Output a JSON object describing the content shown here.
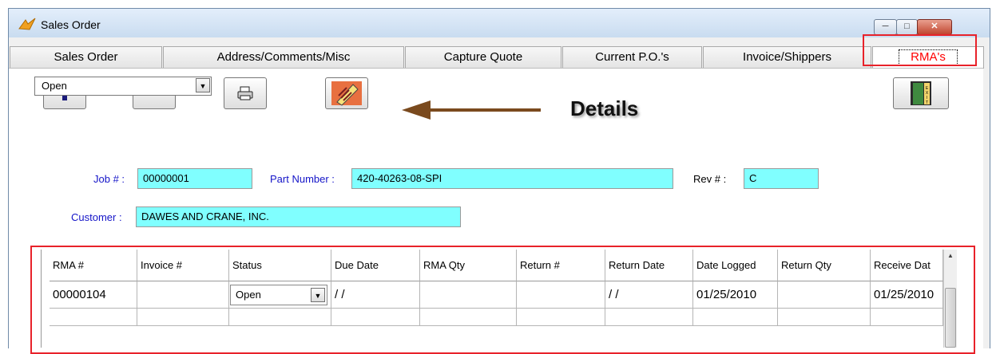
{
  "window": {
    "title": "Sales Order",
    "controls": {
      "minimize": "─",
      "maximize": "□",
      "close": "✕"
    }
  },
  "tabs": [
    {
      "label": "Sales Order",
      "active": false
    },
    {
      "label": "Address/Comments/Misc",
      "active": false
    },
    {
      "label": "Capture Quote",
      "active": false
    },
    {
      "label": "Current P.O.'s",
      "active": false
    },
    {
      "label": "Invoice/Shippers",
      "active": false
    },
    {
      "label": "RMA's",
      "active": true
    }
  ],
  "toolbar": {
    "buttons": [
      "add-icon",
      "remove-icon",
      "print-icon",
      "details-icon",
      "exit-icon"
    ],
    "annotation": "Details"
  },
  "filter": {
    "status_value": "Open"
  },
  "fields": {
    "job_label": "Job # :",
    "job_value": "00000001",
    "part_label": "Part Number :",
    "part_value": "420-40263-08-SPI",
    "rev_label": "Rev  # :",
    "rev_value": "C",
    "customer_label": "Customer :",
    "customer_value": "DAWES AND CRANE, INC."
  },
  "grid": {
    "columns": [
      "RMA #",
      "Invoice #",
      "Status",
      "Due Date",
      "RMA Qty",
      "Return #",
      "Return Date",
      "Date Logged",
      "Return Qty",
      "Receive Dat"
    ],
    "rows": [
      {
        "rma": "00000104",
        "invoice": "",
        "status": "Open",
        "due_date": "/ /",
        "rma_qty": "",
        "return_no": "",
        "return_date": "/ /",
        "date_logged": "01/25/2010",
        "return_qty": "",
        "receive_date": "01/25/2010"
      }
    ]
  },
  "colors": {
    "field_bg": "#80ffff",
    "label_blue": "#1414c8",
    "highlight_red": "#e8222a",
    "active_tab_text": "#ff0000"
  }
}
